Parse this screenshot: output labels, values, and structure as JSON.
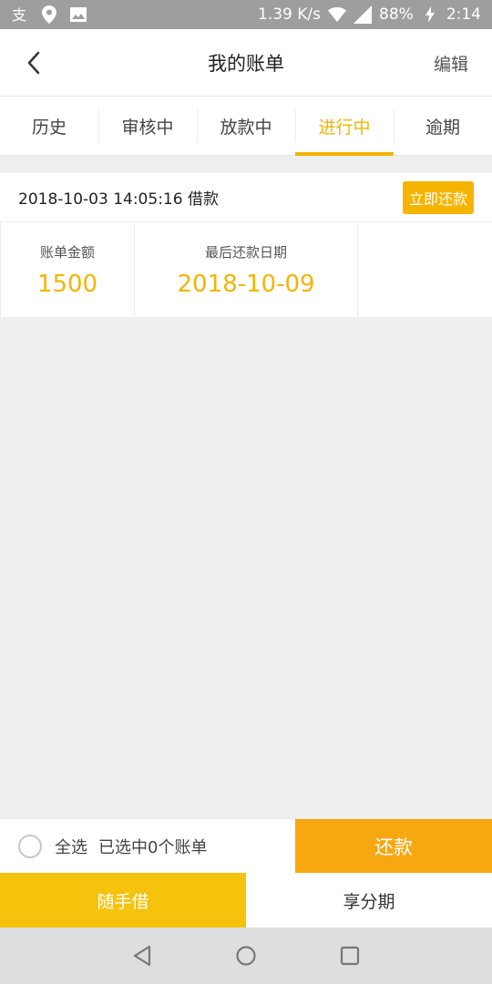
{
  "status_bar": {
    "speed": "1.39 K/s",
    "battery": "88%",
    "time": "2:14"
  },
  "header": {
    "title": "我的账单",
    "edit_label": "编辑"
  },
  "tabs": [
    {
      "label": "历史",
      "active": false
    },
    {
      "label": "审核中",
      "active": false
    },
    {
      "label": "放款中",
      "active": false
    },
    {
      "label": "进行中",
      "active": true
    },
    {
      "label": "逾期",
      "active": false
    }
  ],
  "bill": {
    "datetime": "2018-10-03 14:05:16 借款",
    "repay_now_label": "立即还款",
    "amount_label": "账单金额",
    "amount_value": "1500",
    "due_label": "最后还款日期",
    "due_value": "2018-10-09"
  },
  "select_bar": {
    "select_all_label": "全选",
    "selected_count": "已选中0个账单",
    "repay_label": "还款"
  },
  "bottom_tabs": {
    "left_label": "随手借",
    "right_label": "享分期"
  },
  "colors": {
    "accent": "#f5b400",
    "repay_button": "#f7a70f",
    "bottom_tab_active": "#f5c20c"
  }
}
